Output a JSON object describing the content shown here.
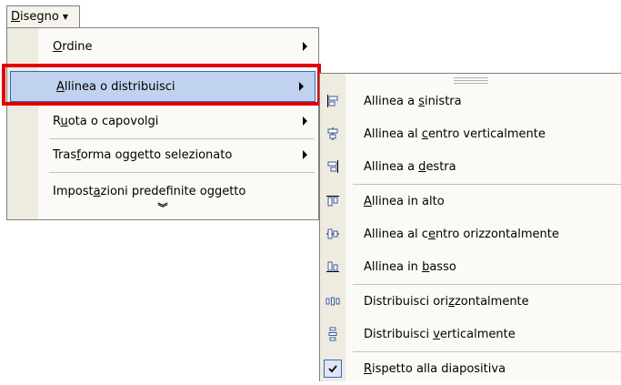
{
  "menubar": {
    "label": "Disegno"
  },
  "main_menu": {
    "items": [
      {
        "label": "Ordine",
        "has_submenu": true
      },
      {
        "label": "Allinea o distribuisci",
        "has_submenu": true,
        "highlighted": true
      },
      {
        "label": "Ruota o capovolgi",
        "has_submenu": true
      },
      {
        "label": "Trasforma oggetto selezionato",
        "has_submenu": true
      },
      {
        "label": "Impostazioni predefinite oggetto",
        "has_submenu": false
      }
    ],
    "expand_icon": "double-chevron-down-icon"
  },
  "submenu": {
    "items": [
      {
        "label": "Allinea a sinistra",
        "icon": "align-left-icon"
      },
      {
        "label": "Allinea al centro verticalmente",
        "icon": "align-center-icon"
      },
      {
        "label": "Allinea a destra",
        "icon": "align-right-icon"
      },
      {
        "label": "Allinea in alto",
        "icon": "align-top-icon"
      },
      {
        "label": "Allinea al centro orizzontalmente",
        "icon": "align-middle-icon"
      },
      {
        "label": "Allinea in basso",
        "icon": "align-bottom-icon"
      },
      {
        "label": "Distribuisci orizzontalmente",
        "icon": "distribute-horizontal-icon"
      },
      {
        "label": "Distribuisci verticalmente",
        "icon": "distribute-vertical-icon"
      },
      {
        "label": "Rispetto alla diapositiva",
        "icon": "checkmark-icon",
        "checked": true
      }
    ]
  },
  "colors": {
    "highlight_fill": "#c1d2ee",
    "highlight_border": "#316ac5",
    "annotation_red": "#e00000",
    "gutter": "#eeebe0"
  }
}
